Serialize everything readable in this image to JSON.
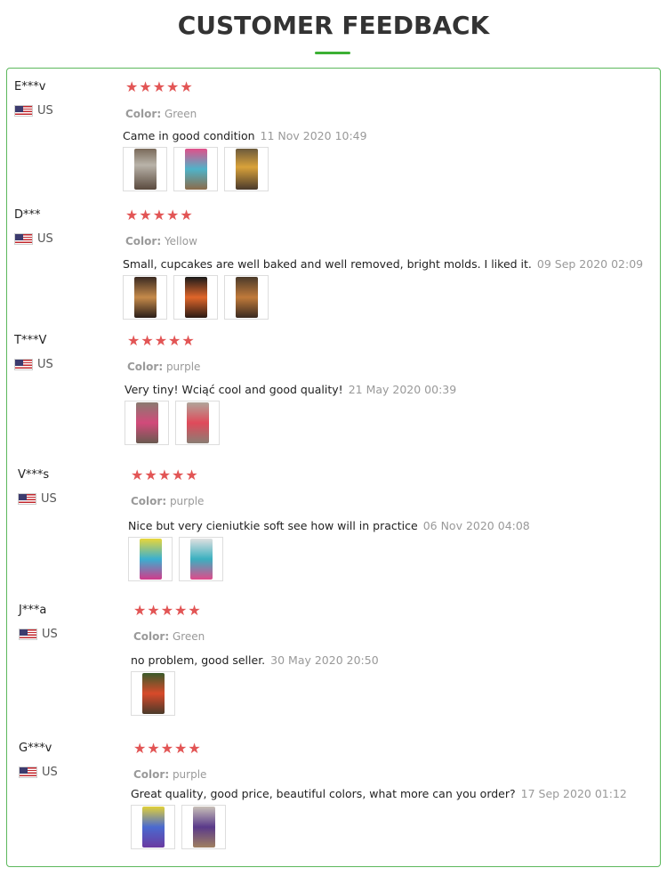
{
  "header": {
    "title": "CUSTOMER FEEDBACK",
    "accent_color": "#3cb034"
  },
  "star_color": "#e25555",
  "star_glyph": "★",
  "color_label": "Color:",
  "reviews": [
    {
      "name": "E***v",
      "country": "US",
      "stars": 5,
      "color": "Green",
      "text": "Came in good condition",
      "date": "11 Nov 2020 10:49",
      "photos": [
        {
          "bg": "linear-gradient(#7a6a5a, #b9b3a9 40%, #5a4a3e)"
        },
        {
          "bg": "linear-gradient(#e0508a, #4fb3c9 50%, #8c6b4a)"
        },
        {
          "bg": "linear-gradient(#6b5a3c, #d9a23a 45%, #4a3a2c)"
        }
      ]
    },
    {
      "name": "D***",
      "country": "US",
      "stars": 5,
      "color": "Yellow",
      "text": "Small, cupcakes are well baked and well removed, bright molds. I liked it.",
      "date": "09 Sep 2020 02:09",
      "photos": [
        {
          "bg": "linear-gradient(#3a2a22, #c58a4a 50%, #2a1e18)"
        },
        {
          "bg": "linear-gradient(#1a1a1a, #e0662a 50%, #2a1a14)"
        },
        {
          "bg": "linear-gradient(#4a3a2a, #c07a3a 50%, #3a2a20)"
        }
      ]
    },
    {
      "name": "T***V",
      "country": "US",
      "stars": 5,
      "color": "purple",
      "text": "Very tiny! Wciąć cool and good quality!",
      "date": "21 May 2020 00:39",
      "photos": [
        {
          "bg": "linear-gradient(#8a7a70, #d24a7a 50%, #6a5a50)"
        },
        {
          "bg": "linear-gradient(#b0a59a, #e04a5a 50%, #8a7e74)"
        }
      ]
    },
    {
      "name": "V***s",
      "country": "US",
      "stars": 5,
      "color": "purple",
      "text": "Nice but very cieniutkie soft see how will in practice",
      "date": "06 Nov 2020 04:08",
      "photos": [
        {
          "bg": "linear-gradient(#e8d63a, #3ab0d0 50%, #d23a8a)"
        },
        {
          "bg": "linear-gradient(#e0e0e0, #3ab0c0 50%, #e04a8a)"
        }
      ]
    },
    {
      "name": "J***a",
      "country": "US",
      "stars": 5,
      "color": "Green",
      "text": "no problem, good seller.",
      "date": "30 May 2020 20:50",
      "photos": [
        {
          "bg": "linear-gradient(#3a5a2a, #d84a2a 50%, #4a3a2a)"
        }
      ]
    },
    {
      "name": "G***v",
      "country": "US",
      "stars": 5,
      "color": "purple",
      "text": "Great quality, good price, beautiful colors, what more can you order?",
      "date": "17 Sep 2020 01:12",
      "photos": [
        {
          "bg": "linear-gradient(#e0d03a, #4a6ad0 50%, #6a3aa0)"
        },
        {
          "bg": "linear-gradient(#c8c0b8, #5a3a8a 50%, #a08060)"
        }
      ]
    }
  ]
}
